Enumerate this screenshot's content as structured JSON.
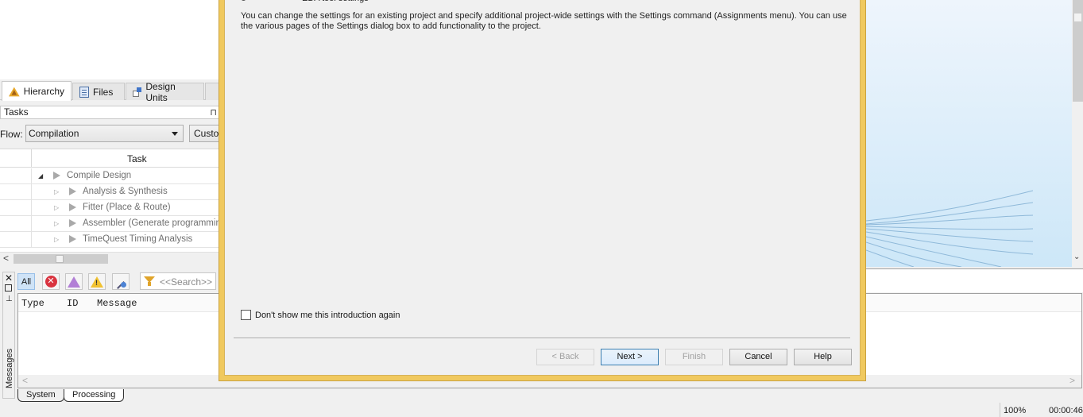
{
  "left_panel": {
    "tabs": [
      {
        "label": "Hierarchy",
        "icon": "hierarchy-warning-icon",
        "active": true
      },
      {
        "label": "Files",
        "icon": "files-icon",
        "active": false
      },
      {
        "label": "Design Units",
        "icon": "design-units-icon",
        "active": false
      }
    ],
    "tasks_header": "Tasks",
    "flow_label": "Flow:",
    "flow_value": "Compilation",
    "custom_button": "Customize...",
    "task_column": "Task",
    "tasks": [
      {
        "label": "Compile Design",
        "level": 0,
        "expanded": true
      },
      {
        "label": "Analysis & Synthesis",
        "level": 1,
        "expanded": false
      },
      {
        "label": "Fitter (Place & Route)",
        "level": 1,
        "expanded": false
      },
      {
        "label": "Assembler (Generate programming files)",
        "level": 1,
        "expanded": false
      },
      {
        "label": "TimeQuest Timing Analysis",
        "level": 1,
        "expanded": false
      }
    ]
  },
  "messages": {
    "side_label": "Messages",
    "filter_all": "All",
    "search_placeholder": "<<Search>>",
    "columns": [
      "Type",
      "ID",
      "Message"
    ],
    "tabs": [
      "System",
      "Processing"
    ],
    "active_tab": "Processing"
  },
  "dialog": {
    "partial_bullet": "EDA tool settings",
    "intro": "You can change the settings for an existing project and specify additional project-wide settings with the Settings command (Assignments menu). You can use the various pages of the Settings dialog box to add functionality to the project.",
    "dont_show_label": "Don't show me this introduction again",
    "dont_show_checked": false,
    "buttons": {
      "back": "< Back",
      "next": "Next >",
      "finish": "Finish",
      "cancel": "Cancel",
      "help": "Help"
    }
  },
  "status_bar": {
    "zoom": "100%",
    "elapsed": "00:00:46"
  },
  "colors": {
    "dialog_frame": "#f0c95f",
    "background_gradient_top": "#eef5fc",
    "background_gradient_bottom": "#cde7f8"
  }
}
